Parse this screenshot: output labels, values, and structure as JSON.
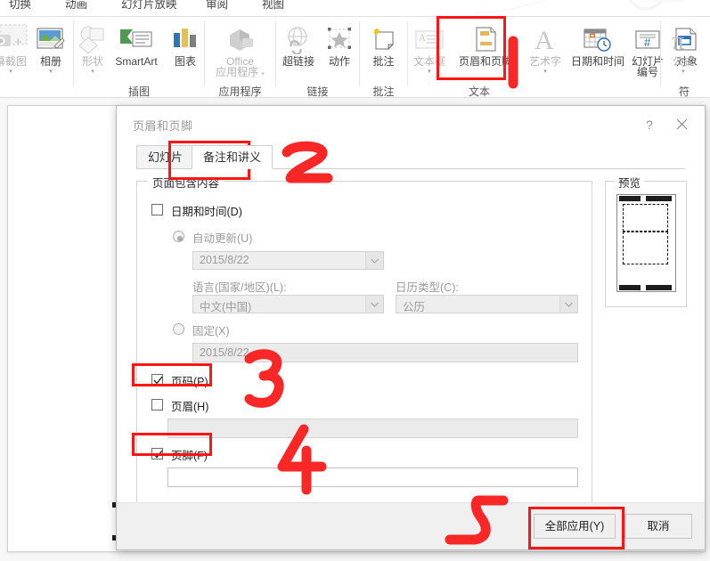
{
  "ribbon": {
    "tabs": [
      "切换",
      "动画",
      "幻灯片放映",
      "审阅",
      "视图"
    ],
    "groups": [
      {
        "label": "",
        "items": [
          {
            "caption": "幕截图",
            "icon": "screenshot-icon",
            "dim": true,
            "caret": true
          },
          {
            "caption": "相册",
            "icon": "photo-album-icon",
            "dim": false,
            "caret": true
          }
        ]
      },
      {
        "label": "插图",
        "items": [
          {
            "caption": "形状",
            "icon": "shapes-icon",
            "dim": true,
            "caret": true
          },
          {
            "caption": "SmartArt",
            "icon": "smartart-icon",
            "dim": false,
            "caret": false
          },
          {
            "caption": "图表",
            "icon": "chart-icon",
            "dim": false,
            "caret": false
          }
        ]
      },
      {
        "label": "应用程序",
        "items": [
          {
            "caption": "Office\n应用程序",
            "icon": "office-apps-icon",
            "dim": true,
            "caret": true
          }
        ]
      },
      {
        "label": "链接",
        "items": [
          {
            "caption": "超链接",
            "icon": "hyperlink-icon",
            "dim": false,
            "caret": false
          },
          {
            "caption": "动作",
            "icon": "action-icon",
            "dim": false,
            "caret": false
          }
        ]
      },
      {
        "label": "批注",
        "items": [
          {
            "caption": "批注",
            "icon": "comment-icon",
            "dim": false,
            "caret": false
          }
        ]
      },
      {
        "label": "文本",
        "items": [
          {
            "caption": "文本框",
            "icon": "textbox-icon",
            "dim": true,
            "caret": true
          },
          {
            "caption": "页眉和页脚",
            "icon": "header-footer-icon",
            "dim": false,
            "caret": false
          },
          {
            "caption": "艺术字",
            "icon": "wordart-icon",
            "dim": true,
            "caret": true
          },
          {
            "caption": "日期和时间",
            "icon": "date-time-icon",
            "dim": false,
            "caret": false
          },
          {
            "caption": "幻灯片\n编号",
            "icon": "slide-number-icon",
            "dim": false,
            "caret": false
          },
          {
            "caption": "对象",
            "icon": "object-icon",
            "dim": false,
            "caret": false
          }
        ]
      },
      {
        "label": "符",
        "items": [
          {
            "caption": "公式",
            "icon": "equation-icon",
            "dim": true,
            "caret": true
          }
        ]
      }
    ]
  },
  "dialog": {
    "title": "页眉和页脚",
    "help_glyph": "?",
    "close_glyph": "✕",
    "tabs": [
      {
        "label": "幻灯片",
        "active": false
      },
      {
        "label": "备注和讲义",
        "active": true
      }
    ],
    "group_legend": "页面包含内容",
    "date_time": {
      "label": "日期和时间(D)",
      "checked": false,
      "auto_update": {
        "label": "自动更新(U)",
        "selected": true,
        "value": "2015/8/22"
      },
      "language": {
        "label": "语言(国家/地区)(L):",
        "value": "中文(中国)"
      },
      "calendar": {
        "label": "日历类型(C):",
        "value": "公历"
      },
      "fixed": {
        "label": "固定(X)",
        "selected": false,
        "value": "2015/8/22"
      }
    },
    "page_number": {
      "label": "页码(P)",
      "checked": true
    },
    "header": {
      "label": "页眉(H)",
      "checked": false,
      "value": ""
    },
    "footer": {
      "label": "页脚(F)",
      "checked": true,
      "value": ""
    },
    "preview_legend": "预览",
    "buttons": {
      "apply_all": "全部应用(Y)",
      "cancel": "取消"
    }
  },
  "annotations": {
    "colors": {
      "highlight": "#ff1414",
      "marker": "#fa2727"
    },
    "marks": [
      {
        "label": "1",
        "target": "header-footer-ribbon-button"
      },
      {
        "label": "2",
        "target": "notes-handouts-tab"
      },
      {
        "label": "3",
        "target": "page-number-checkbox"
      },
      {
        "label": "4",
        "target": "footer-checkbox"
      },
      {
        "label": "5",
        "target": "apply-all-button"
      }
    ]
  }
}
